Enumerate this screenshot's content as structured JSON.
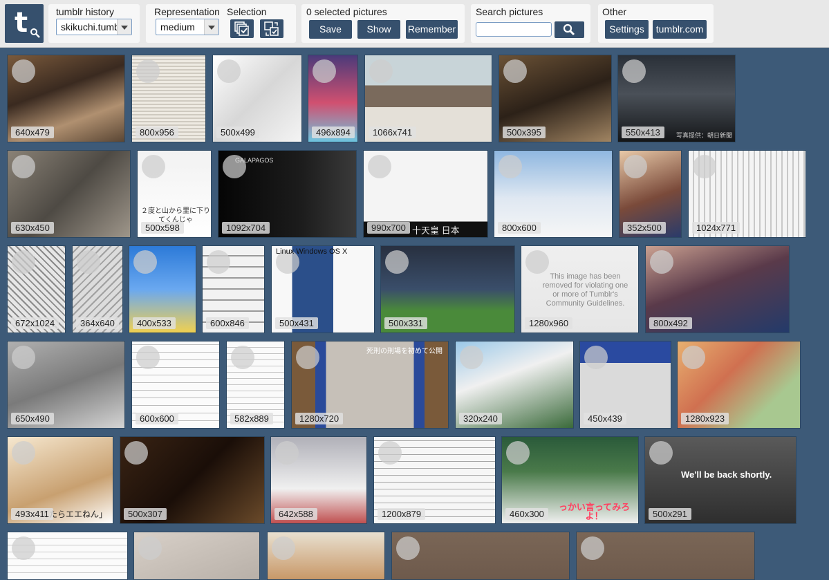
{
  "toolbar": {
    "history_label": "tumblr history",
    "history_value": "skikuchi.tumblr",
    "representation_label": "Representation",
    "representation_value": "medium",
    "selection_label": "Selection",
    "selected_count_label": "0 selected pictures",
    "save_label": "Save",
    "show_label": "Show",
    "remember_label": "Remember",
    "search_label": "Search pictures",
    "search_value": "",
    "other_label": "Other",
    "settings_label": "Settings",
    "tumblr_label": "tumblr.com"
  },
  "colors": {
    "toolbar_bg": "#e8e8e8",
    "accent": "#36506d",
    "page_bg": "#3d5a78"
  },
  "thumbnails": [
    {
      "dim": "640x479",
      "bg": "linear-gradient(160deg,#7a5a3c,#3a2a20 40%,#b09070 70%,#5a4634)"
    },
    {
      "dim": "800x956",
      "bg": "repeating-linear-gradient(0deg,#eeeae2 0 3px,#cfcac0 3px 5px)"
    },
    {
      "dim": "500x499",
      "bg": "linear-gradient(135deg,#ffffff,#d7d7d7 50%,#f4f4f4)"
    },
    {
      "dim": "496x894",
      "bg": "linear-gradient(180deg,#4b3a7a,#d05070 55%,#6ec5e0)"
    },
    {
      "dim": "1066x741",
      "bg": "linear-gradient(180deg,#c8d4d8 0 35%,#7a6a5c 35% 60%,#e4e0d8 60%)"
    },
    {
      "dim": "500x395",
      "bg": "linear-gradient(160deg,#6b5236,#2c2118 50%,#a08462)"
    },
    {
      "dim": "550x413",
      "bg": "linear-gradient(180deg,#2a3038,#4a5058 45%,#141618)",
      "cap": "写真提供：朝日新聞",
      "capcolor": "#ccc"
    },
    {
      "dim": "630x450",
      "bg": "linear-gradient(135deg,#8a8276,#4e4a44 50%,#9e968a)"
    },
    {
      "dim": "500x598",
      "bg": "linear-gradient(180deg,#f2f2f2,#ffffff)",
      "cap": "２度と山から里に下りてくんじゃ",
      "capcolor": "#333"
    },
    {
      "dim": "1092x704",
      "bg": "linear-gradient(90deg,#050505,#1c1c1c 60%,#3a3a3a)",
      "cap": "GALAPAGOS",
      "capcolor": "#ddd"
    },
    {
      "dim": "990x700",
      "bg": "linear-gradient(180deg,#f4f4f4 0 82%,#111 82%)",
      "cap": "十天皇 日本",
      "capcolor": "#e8e8e8"
    },
    {
      "dim": "800x600",
      "bg": "linear-gradient(180deg,#8fb7e0,#dfe8f2 55%,#f6f6f6)"
    },
    {
      "dim": "352x500",
      "bg": "linear-gradient(160deg,#e8c9a8,#7a4a3a 55%,#2a3b6a)"
    },
    {
      "dim": "1024x771",
      "bg": "repeating-linear-gradient(90deg,#f4f4f4 0 6px,#c8c8c8 6px 8px)"
    },
    {
      "dim": "672x1024",
      "bg": "repeating-linear-gradient(45deg,#e6e6e6 0 5px,#8a8a8a 5px 7px)"
    },
    {
      "dim": "364x640",
      "bg": "repeating-linear-gradient(135deg,#dcdcdc 0 6px,#a0a0a0 6px 8px)"
    },
    {
      "dim": "400x533",
      "bg": "linear-gradient(180deg,#2c7ad8,#6aa8f0 50%,#f0d050)"
    },
    {
      "dim": "600x846",
      "bg": "repeating-linear-gradient(0deg,#f2f2f2 0 14px,#9a9a9a 14px 16px)"
    },
    {
      "dim": "500x431",
      "bg": "linear-gradient(90deg,#f8f8f8 0 20%,#2b4f8a 20% 60%,#f8f8f8 60%)",
      "cap": "Linux   Windows   OS X",
      "capcolor": "#111"
    },
    {
      "dim": "500x331",
      "bg": "linear-gradient(180deg,#283040,#3a4e6a 50%,#4a8a3a 75%)"
    },
    {
      "dim": "1280x960",
      "bg": "linear-gradient(180deg,#efefef,#e6e6e6)",
      "cap": "This image has been removed for violating one or more of Tumblr's Community Guidelines.",
      "capcolor": "#8a8a8a"
    },
    {
      "dim": "800x492",
      "bg": "linear-gradient(160deg,#caa090,#5a3a4a 45%,#233a6a)"
    },
    {
      "dim": "650x490",
      "bg": "linear-gradient(160deg,#b0b0b0,#7a7a7a 50%,#d4d4d4)"
    },
    {
      "dim": "600x600",
      "bg": "repeating-linear-gradient(0deg,#fbfbfb 0 10px,#bdbdbd 10px 11px)"
    },
    {
      "dim": "582x889",
      "bg": "repeating-linear-gradient(0deg,#fafafa 0 8px,#c4c4c4 8px 9px)"
    },
    {
      "dim": "1280x720",
      "bg": "linear-gradient(90deg,#7a5a3a 0 15%,#2a4a9a 15% 22%,#c6c0b8 22% 78%,#2a4a9a 78% 85%,#7a5a3a 85%)",
      "cap": "死刑の刑場を初めて公開",
      "capcolor": "#fff"
    },
    {
      "dim": "320x240",
      "bg": "linear-gradient(160deg,#9ac8e8,#f0f0f0 40%,#3a6a3a)"
    },
    {
      "dim": "450x439",
      "bg": "linear-gradient(180deg,#2a4aa0 0 25%,#dadada 25%)"
    },
    {
      "dim": "1280x923",
      "bg": "linear-gradient(135deg,#e8b070,#d07050 40%,#a8c890 75%)"
    },
    {
      "dim": "493x411",
      "bg": "linear-gradient(160deg,#f6e8d0,#c8a070 60%,#fff)",
      "cap": "てたらエエねん」",
      "capcolor": "#222"
    },
    {
      "dim": "500x307",
      "bg": "linear-gradient(135deg,#3a2414,#1a0e08 50%,#6a4a2a)"
    },
    {
      "dim": "642x588",
      "bg": "linear-gradient(180deg,#b0b0b8,#f0f0f0 60%,#c05050)"
    },
    {
      "dim": "1200x879",
      "bg": "repeating-linear-gradient(0deg,#f6f6f6 0 9px,#a6a6a6 9px 10px)"
    },
    {
      "dim": "460x300",
      "bg": "linear-gradient(180deg,#2a5a3a,#4a7a4a 40%,#f0f0f0)",
      "cap": "っかい言ってみろよ！",
      "capcolor": "#ff4060"
    },
    {
      "dim": "500x291",
      "bg": "linear-gradient(180deg,#5a5a5a,#2e2e2e)",
      "cap": "We'll be back shortly.",
      "capcolor": "#ffffff"
    },
    {
      "dim": "",
      "bg": "repeating-linear-gradient(0deg,#fbfbfb 0 9px,#c8c8c8 9px 10px)"
    },
    {
      "dim": "",
      "bg": "linear-gradient(160deg,#d8d0c8,#b8b0a8)"
    },
    {
      "dim": "",
      "bg": "linear-gradient(180deg,#e8e0d0,#c89868)"
    },
    {
      "dim": "",
      "bg": "linear-gradient(180deg,#7a6656,#6e5a4c)"
    },
    {
      "dim": "",
      "bg": "linear-gradient(180deg,#7a6656,#6e5a4c)"
    }
  ]
}
